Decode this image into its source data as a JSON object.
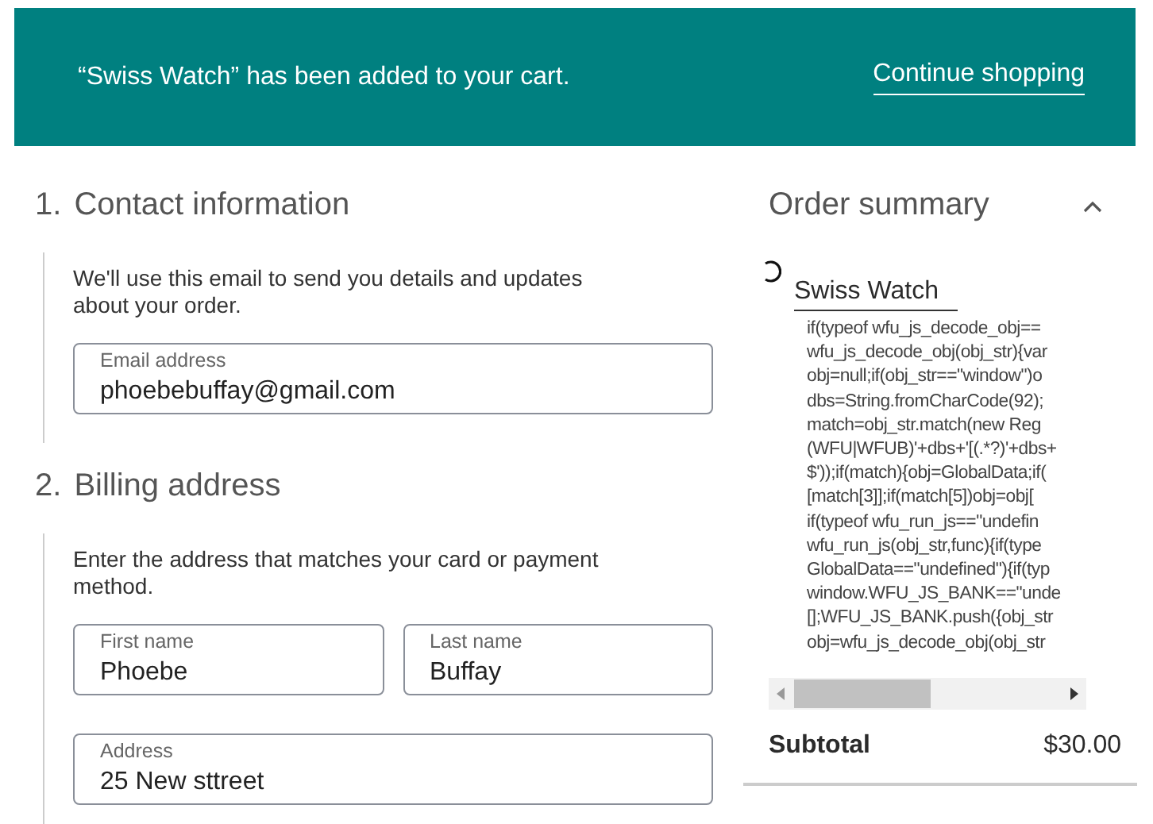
{
  "notice": {
    "message": "“Swiss Watch” has been added to your cart.",
    "link": "Continue shopping"
  },
  "sections": [
    {
      "number": "1.",
      "title": "Contact information",
      "description": "We'll use this email to send you details and updates about your order.",
      "field_rows": [
        [
          {
            "label": "Email address",
            "value": "phoebebuffay@gmail.com"
          }
        ]
      ]
    },
    {
      "number": "2.",
      "title": "Billing address",
      "description": "Enter the address that matches your card or payment method.",
      "field_rows": [
        [
          {
            "label": "First name",
            "value": "Phoebe"
          },
          {
            "label": "Last name",
            "value": "Buffay"
          }
        ],
        [
          {
            "label": "Address",
            "value": "25 New sttreet"
          }
        ]
      ]
    }
  ],
  "order_summary": {
    "title": "Order summary",
    "expanded": true,
    "product_name": "Swiss Watch",
    "code_lines": [
      "if(typeof wfu_js_decode_obj==",
      "wfu_js_decode_obj(obj_str){var",
      "obj=null;if(obj_str==\"window\")o",
      "dbs=String.fromCharCode(92);",
      "match=obj_str.match(new Reg",
      "(WFU|WFUB)'+dbs+'[(.*?)'+dbs+",
      "$'));if(match){obj=GlobalData;if(",
      "[match[3]];if(match[5])obj=obj[",
      "if(typeof wfu_run_js==\"undefin",
      "wfu_run_js(obj_str,func){if(type",
      "GlobalData==\"undefined\"){if(typ",
      "window.WFU_JS_BANK==\"unde",
      "[];WFU_JS_BANK.push({obj_str",
      "obj=wfu_js_decode_obj(obj_str"
    ],
    "subtotal_label": "Subtotal",
    "subtotal_value": "$30.00"
  }
}
